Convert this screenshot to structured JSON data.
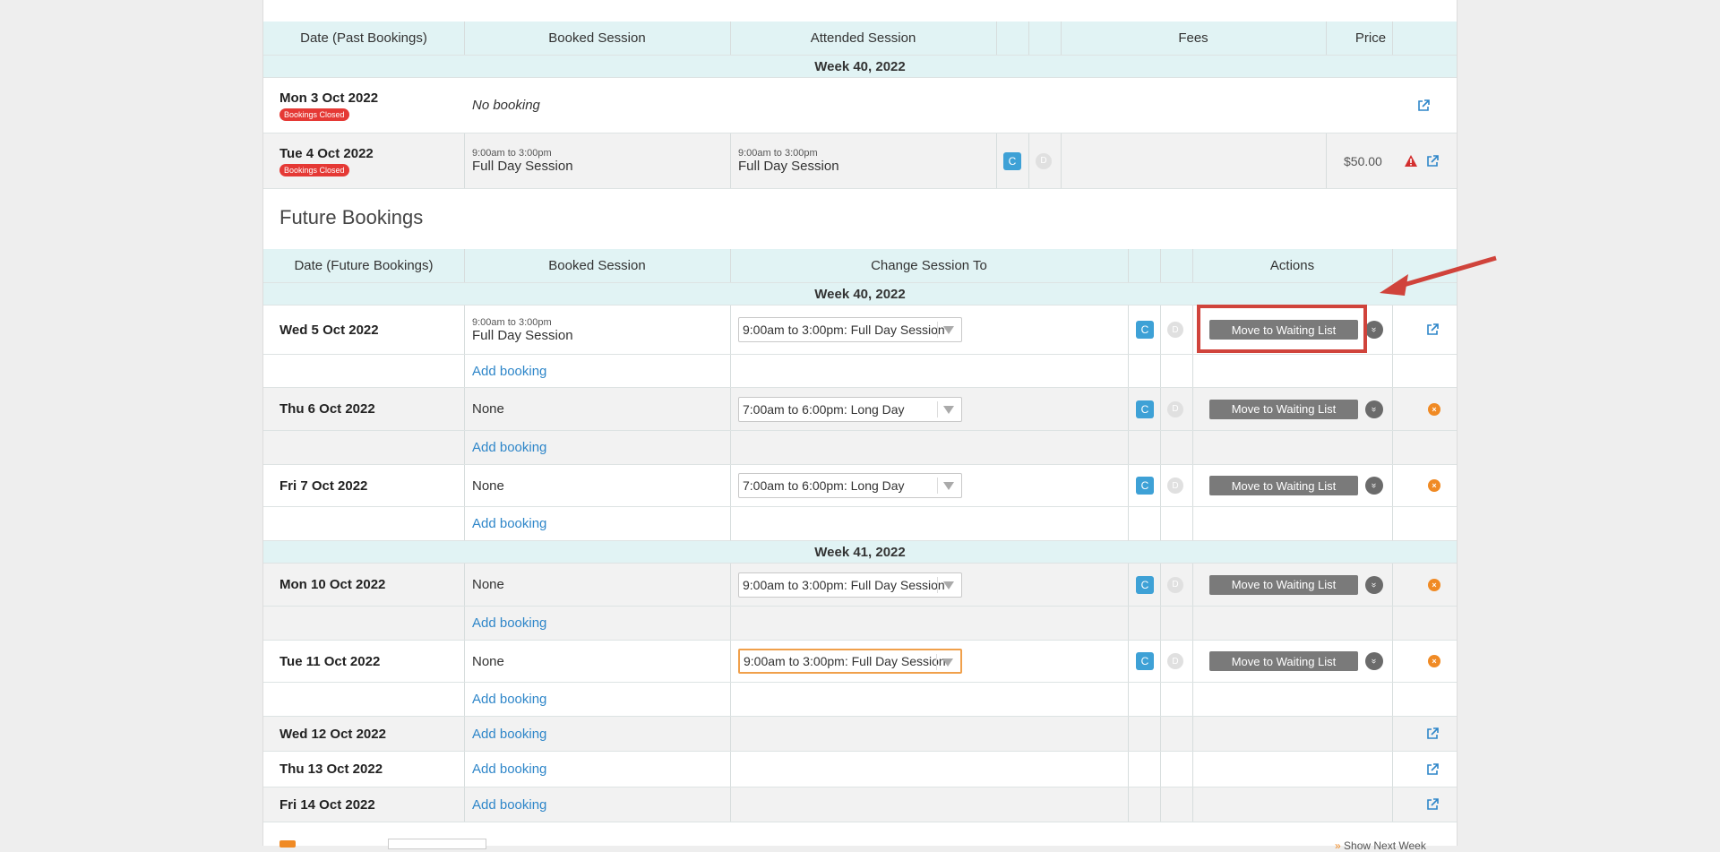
{
  "past": {
    "headers": {
      "date": "Date (Past Bookings)",
      "booked": "Booked Session",
      "attended": "Attended Session",
      "fees": "Fees",
      "price": "Price"
    },
    "week": "Week 40, 2022",
    "rows": [
      {
        "date": "Mon 3 Oct 2022",
        "badge": "Bookings Closed",
        "booked": "No booking"
      },
      {
        "date": "Tue 4 Oct 2022",
        "badge": "Bookings Closed",
        "booked_time": "9:00am to 3:00pm",
        "booked": "Full Day Session",
        "att_time": "9:00am to 3:00pm",
        "attended": "Full Day Session",
        "c": "C",
        "d": "D",
        "price": "$50.00"
      }
    ]
  },
  "future": {
    "title": "Future Bookings",
    "headers": {
      "date": "Date (Future Bookings)",
      "booked": "Booked Session",
      "change": "Change Session To",
      "actions": "Actions"
    },
    "week40": "Week 40, 2022",
    "week41": "Week 41, 2022",
    "add_label": "Add booking",
    "mwl_label": "Move to Waiting List",
    "c": "C",
    "d": "D",
    "rows": [
      {
        "date": "Wed 5 Oct 2022",
        "booked_time": "9:00am to 3:00pm",
        "booked": "Full Day Session",
        "select": "9:00am to 3:00pm: Full Day Session"
      },
      {
        "date": "Thu 6 Oct 2022",
        "booked": "None",
        "select": "7:00am to 6:00pm: Long Day"
      },
      {
        "date": "Fri 7 Oct 2022",
        "booked": "None",
        "select": "7:00am to 6:00pm: Long Day"
      },
      {
        "date": "Mon 10 Oct 2022",
        "booked": "None",
        "select": "9:00am to 3:00pm: Full Day Session"
      },
      {
        "date": "Tue 11 Oct 2022",
        "booked": "None",
        "select": "9:00am to 3:00pm: Full Day Session"
      },
      {
        "date": "Wed 12 Oct 2022"
      },
      {
        "date": "Thu 13 Oct 2022"
      },
      {
        "date": "Fri 14 Oct 2022"
      }
    ]
  },
  "footer": {
    "show_next": "Show Next Week"
  },
  "colors": {
    "accent": "#2e86c9",
    "header_bg": "#e1f3f4",
    "highlight": "#d0433b"
  }
}
